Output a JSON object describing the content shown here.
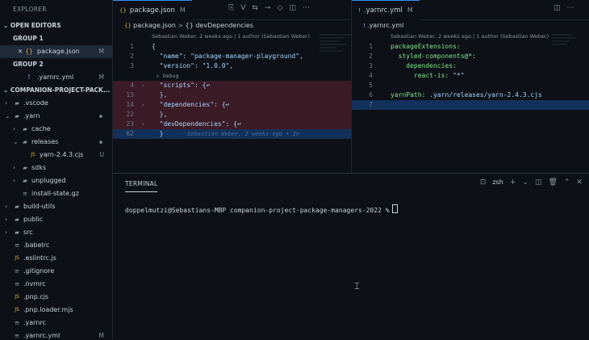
{
  "explorer": {
    "title": "EXPLORER",
    "open_editors_label": "OPEN EDITORS",
    "group1_label": "GROUP 1",
    "group1_file": {
      "name": "package.json",
      "badge": "M"
    },
    "group2_label": "GROUP 2",
    "group2_file": {
      "name": ".yarnrc.yml",
      "badge": "M"
    },
    "project_label": "COMPANION-PROJECT-PACK...",
    "tree": [
      {
        "name": ".vscode",
        "type": "folder",
        "depth": 1,
        "open": false
      },
      {
        "name": ".yarn",
        "type": "folder",
        "depth": 1,
        "open": true
      },
      {
        "name": "cache",
        "type": "folder",
        "depth": 2,
        "open": false
      },
      {
        "name": "releases",
        "type": "folder",
        "depth": 2,
        "open": true
      },
      {
        "name": "yarn-2.4.3.cjs",
        "type": "js",
        "depth": 3,
        "badge": "U"
      },
      {
        "name": "sdks",
        "type": "folder",
        "depth": 2,
        "open": false
      },
      {
        "name": "unplugged",
        "type": "folder",
        "depth": 2,
        "open": false
      },
      {
        "name": "install-state.gz",
        "type": "file",
        "depth": 2
      },
      {
        "name": "build-utils",
        "type": "folder",
        "depth": 1,
        "open": false
      },
      {
        "name": "public",
        "type": "folder",
        "depth": 1,
        "open": false
      },
      {
        "name": "src",
        "type": "folder",
        "depth": 1,
        "open": false
      },
      {
        "name": ".babelrc",
        "type": "file",
        "depth": 1
      },
      {
        "name": ".eslintrc.js",
        "type": "js",
        "depth": 1
      },
      {
        "name": ".gitignore",
        "type": "file",
        "depth": 1
      },
      {
        "name": ".nvmrc",
        "type": "file",
        "depth": 1
      },
      {
        "name": ".pnp.cjs",
        "type": "js",
        "depth": 1
      },
      {
        "name": ".pnp.loader.mjs",
        "type": "js",
        "depth": 1
      },
      {
        "name": ".yarnrc",
        "type": "file",
        "depth": 1
      },
      {
        "name": ".yarnrc.yml",
        "type": "file",
        "depth": 1,
        "badge": "M"
      }
    ]
  },
  "left_editor": {
    "tab": {
      "name": "package.json",
      "badge": "M"
    },
    "breadcrumb_file": "package.json",
    "breadcrumb_sep": ">",
    "breadcrumb_symbol": "{} devDependencies",
    "blame": "Sebastian Weber, 2 weeks ago | 1 author (Sebastian Weber)",
    "debug_label": "▷ Debug",
    "lines": [
      {
        "n": "1",
        "text": "{",
        "hl": ""
      },
      {
        "n": "2",
        "text": "  \"name\": \"package-manager-playground\",",
        "hl": ""
      },
      {
        "n": "3",
        "text": "  \"version\": \"1.0.0\",",
        "hl": ""
      },
      {
        "n": "4",
        "text": "  \"scripts\": {↩",
        "hl": "red",
        "fold": true
      },
      {
        "n": "13",
        "text": "  },",
        "hl": "red"
      },
      {
        "n": "14",
        "text": "  \"dependencies\": {↩",
        "hl": "red",
        "fold": true
      },
      {
        "n": "22",
        "text": "  },",
        "hl": "red"
      },
      {
        "n": "23",
        "text": "  \"devDependencies\": {↩",
        "hl": "red",
        "fold": true
      },
      {
        "n": "62",
        "text": "  }",
        "hl": "blue",
        "ghost": "Sebastian Weber, 2 weeks ago • In"
      }
    ]
  },
  "right_editor": {
    "tab": {
      "name": ".yarnrc.yml",
      "badge": "M"
    },
    "breadcrumb_file": ".yarnrc.yml",
    "blame": "Sebastian Weber, 2 weeks ago | 1 author (Sebastian Weber)",
    "lines": [
      {
        "n": "1",
        "key": "packageExtensions:",
        "val": ""
      },
      {
        "n": "2",
        "key": "  styled-components@*:",
        "val": ""
      },
      {
        "n": "3",
        "key": "    dependencies:",
        "val": ""
      },
      {
        "n": "4",
        "key": "      react-is:",
        "val": " \"*\""
      },
      {
        "n": "5",
        "key": "",
        "val": ""
      },
      {
        "n": "6",
        "key": "yarnPath:",
        "val": " .yarn/releases/yarn-2.4.3.cjs"
      },
      {
        "n": "7",
        "key": "",
        "val": ""
      }
    ]
  },
  "terminal": {
    "tab_label": "TERMINAL",
    "shell": "zsh",
    "prompt": "doppelmutzi@Sebastians-MBP companion-project-package-managers-2022 %"
  },
  "colors": {
    "background": "#0d1117",
    "accent": "#388bfd",
    "folded_highlight": "#3b1b26",
    "current_line": "#13305a"
  }
}
